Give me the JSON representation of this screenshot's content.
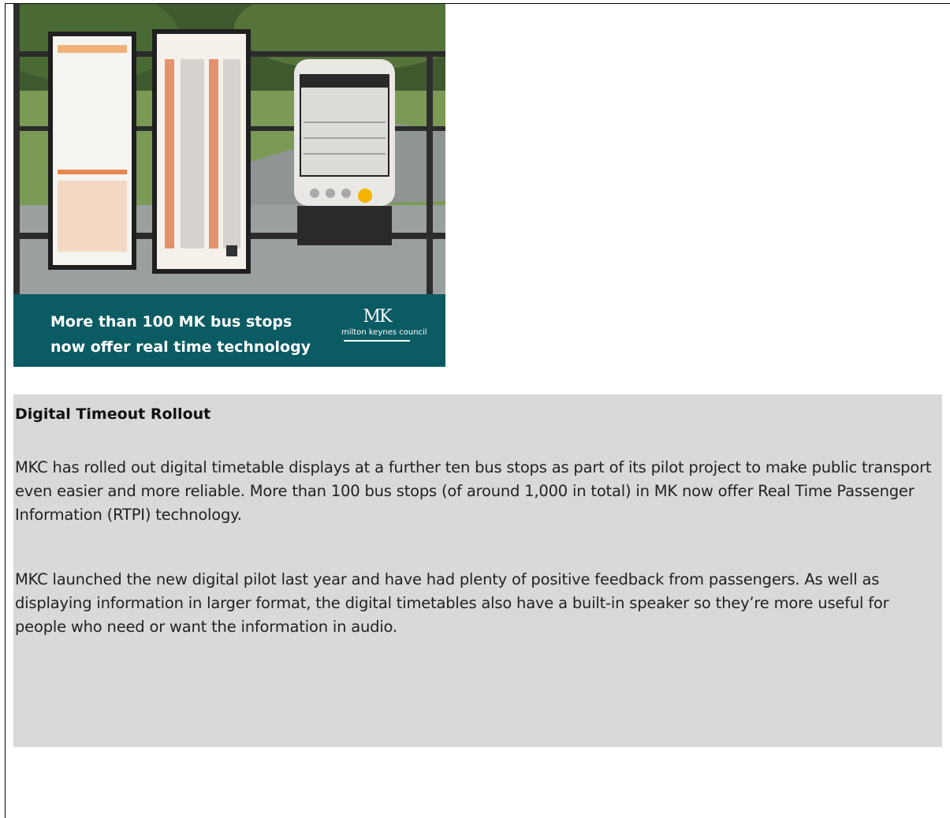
{
  "image": {
    "banner_line1": "More than 100 MK bus stops",
    "banner_line2": "now offer real time technology",
    "logo_mark": "MK",
    "logo_text": "milton keynes council",
    "banner_color": "#0b5b63"
  },
  "article": {
    "title": "Digital Timeout Rollout",
    "paragraph1": "MKC has rolled out digital timetable displays at a further ten bus stops as part of its pilot project to make public transport even easier and more reliable.  More than 100 bus stops (of around 1,000 in total) in MK now offer Real Time Passenger Information (RTPI) technology.",
    "paragraph2": "MKC launched the new digital pilot last year and have had plenty of positive feedback from passengers.  As well as displaying information in larger format, the digital timetables also have a built-in speaker so they’re more useful for people who need or want the information in audio.",
    "background": "#d9d9d9"
  }
}
